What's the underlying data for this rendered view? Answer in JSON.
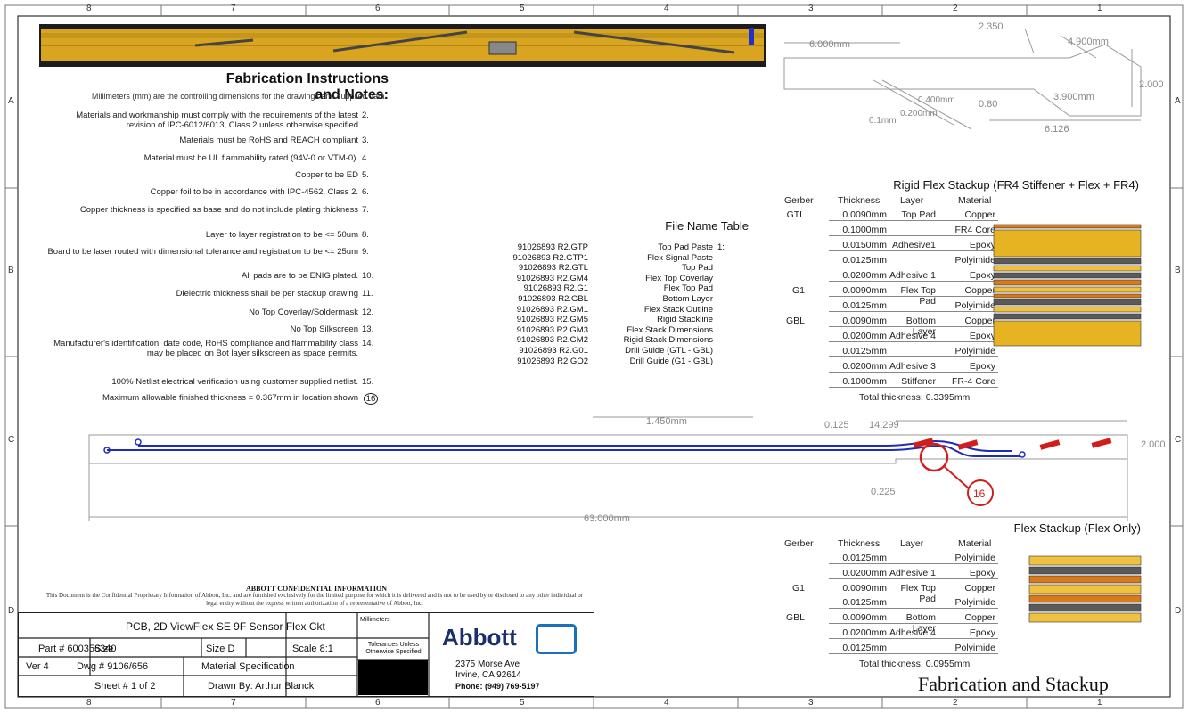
{
  "sheet": {
    "title": "Fabrication and Stackup",
    "zone_cols": [
      "8",
      "7",
      "6",
      "5",
      "4",
      "3",
      "2",
      "1"
    ],
    "zone_rows": [
      "A",
      "B",
      "C",
      "D"
    ]
  },
  "notes": {
    "heading": "Fabrication Instructions and Notes:",
    "subheading": "Millimeters (mm) are the controlling dimensions for the drawings and supplied data.",
    "items": [
      {
        "num": "2.",
        "text": "Materials and workmanship must comply with the requirements of the latest revision of IPC-6012/6013, Class 2 unless otherwise specified"
      },
      {
        "num": "3.",
        "text": "Materials must be RoHS and REACH compliant"
      },
      {
        "num": "4.",
        "text": "Material must be UL flammability rated (94V-0 or VTM-0)."
      },
      {
        "num": "5.",
        "text": "Copper to be ED"
      },
      {
        "num": "6.",
        "text": "Copper foil to be in accordance with IPC-4562, Class 2."
      },
      {
        "num": "7.",
        "text": "Copper thickness is specified as base and do not include plating thickness"
      },
      {
        "num": "8.",
        "text": "Layer to layer registration to be <= 50um"
      },
      {
        "num": "9.",
        "text": "Board to be laser routed with dimensional tolerance and registration to be <= 25um"
      },
      {
        "num": "10.",
        "text": "All pads are to be ENIG plated."
      },
      {
        "num": "11.",
        "text": "Dielectric thickness shall be per stackup drawing"
      },
      {
        "num": "12.",
        "text": "No Top Coverlay/Soldermask"
      },
      {
        "num": "13.",
        "text": "No Top Silkscreen"
      },
      {
        "num": "14.",
        "text": "Manufacturer's identification, date code, RoHS compliance and flammability class may be placed on Bot layer silkscreen as space permits."
      },
      {
        "num": "15.",
        "text": "100% Netlist electrical verification using customer supplied netlist."
      },
      {
        "num": "16",
        "text": "Maximum allowable finished thickness = 0.367mm in location shown"
      }
    ]
  },
  "file_table": {
    "heading": "File Name Table",
    "rows": [
      {
        "idx": "1:",
        "name": "Top Pad Paste",
        "file": "91026893 R2.GTP"
      },
      {
        "idx": "",
        "name": "Flex Signal Paste",
        "file": "91026893 R2.GTP1"
      },
      {
        "idx": "",
        "name": "Top Pad",
        "file": "91026893 R2.GTL"
      },
      {
        "idx": "",
        "name": "Flex Top Coverlay",
        "file": "91026893 R2.GM4"
      },
      {
        "idx": "",
        "name": "Flex Top Pad",
        "file": "91026893 R2.G1"
      },
      {
        "idx": "",
        "name": "Bottom Layer",
        "file": "91026893 R2.GBL"
      },
      {
        "idx": "",
        "name": "Flex Stack Outline",
        "file": "91026893 R2.GM1"
      },
      {
        "idx": "",
        "name": "Rigid Stackline",
        "file": "91026893 R2.GM5"
      },
      {
        "idx": "",
        "name": "Flex Stack Dimensions",
        "file": "91026893 R2.GM3"
      },
      {
        "idx": "",
        "name": "Rigid Stack Dimensions",
        "file": "91026893 R2.GM2"
      },
      {
        "idx": "",
        "name": "Drill Guide (GTL - GBL)",
        "file": "91026893 R2.G01"
      },
      {
        "idx": "",
        "name": "Drill Guide (G1 - GBL)",
        "file": "91026893 R2.GO2"
      }
    ]
  },
  "rigid_stack": {
    "heading": "Rigid Flex Stackup (FR4 Stiffener + Flex + FR4)",
    "cols": [
      "Material",
      "Layer",
      "Thickness",
      "Gerber"
    ],
    "rows": [
      {
        "material": "Copper",
        "layer": "Top Pad",
        "thickness": "0.0090mm",
        "gerber": "GTL"
      },
      {
        "material": "FR4 Core",
        "layer": "",
        "thickness": "0.1000mm",
        "gerber": ""
      },
      {
        "material": "Epoxy",
        "layer": "Adhesive1",
        "thickness": "0.0150mm",
        "gerber": ""
      },
      {
        "material": "Polyimide",
        "layer": "",
        "thickness": "0.0125mm",
        "gerber": ""
      },
      {
        "material": "Epoxy",
        "layer": "Adhesive 1",
        "thickness": "0.0200mm",
        "gerber": ""
      },
      {
        "material": "Copper",
        "layer": "Flex Top Pad",
        "thickness": "0.0090mm",
        "gerber": "G1"
      },
      {
        "material": "Polyimide",
        "layer": "",
        "thickness": "0.0125mm",
        "gerber": ""
      },
      {
        "material": "Copper",
        "layer": "Bottom Layer",
        "thickness": "0.0090mm",
        "gerber": "GBL"
      },
      {
        "material": "Epoxy",
        "layer": "Adhesive 4",
        "thickness": "0.0200mm",
        "gerber": ""
      },
      {
        "material": "Polyimide",
        "layer": "",
        "thickness": "0.0125mm",
        "gerber": ""
      },
      {
        "material": "Epoxy",
        "layer": "Adhesive 3",
        "thickness": "0.0200mm",
        "gerber": ""
      },
      {
        "material": "FR-4 Core",
        "layer": "Stiffener",
        "thickness": "0.1000mm",
        "gerber": ""
      }
    ],
    "total": "Total thickness: 0.3395mm"
  },
  "flex_stack": {
    "heading": "Flex Stackup (Flex Only)",
    "cols": [
      "Material",
      "Layer",
      "Thickness",
      "Gerber"
    ],
    "rows": [
      {
        "material": "Polyimide",
        "layer": "",
        "thickness": "0.0125mm",
        "gerber": ""
      },
      {
        "material": "Epoxy",
        "layer": "Adhesive 1",
        "thickness": "0.0200mm",
        "gerber": ""
      },
      {
        "material": "Copper",
        "layer": "Flex Top Pad",
        "thickness": "0.0090mm",
        "gerber": "G1"
      },
      {
        "material": "Polyimide",
        "layer": "",
        "thickness": "0.0125mm",
        "gerber": ""
      },
      {
        "material": "Copper",
        "layer": "Bottom Layer",
        "thickness": "0.0090mm",
        "gerber": "GBL"
      },
      {
        "material": "Epoxy",
        "layer": "Adhesive 4",
        "thickness": "0.0200mm",
        "gerber": ""
      },
      {
        "material": "Polyimide",
        "layer": "",
        "thickness": "0.0125mm",
        "gerber": ""
      }
    ],
    "total": "Total thickness: 0.0955mm"
  },
  "dims": {
    "top_right": [
      "6.000mm",
      "2.350",
      "4.900mm",
      "3.900mm",
      "2.000",
      "0.80",
      "6.126",
      "0.400mm",
      "0.200mm",
      "0.1mm"
    ],
    "board": [
      "14.299",
      "1.450mm",
      "0.125",
      "2.000",
      "0.225",
      "63.000mm"
    ],
    "callout": "16"
  },
  "confidential": {
    "heading": "ABBOTT CONFIDENTIAL INFORMATION",
    "text": "This Document is the Confidential Proprietary Information of Abbott, Inc. and are furnished exclusively for the limited purpose for which it is delivered and is not to be used by or disclosed to any other individual or legal entity without the express written authorization of a representative of Abbott, Inc."
  },
  "title_block": {
    "company": "Abbott",
    "address1": "2375 Morse Ave",
    "address2": "Irvine, CA 92614",
    "phone": "Phone: (949) 769-5197",
    "units": "Millimeters",
    "tolerance": "Tolerances Unless Otherwise Specified",
    "title": "PCB, 2D ViewFlex SE 9F Sensor Flex Ckt",
    "scale": "Scale 8:1",
    "size_label": "Size D",
    "size": "Size",
    "part": "Part # 600356340",
    "spec": "Material Specification",
    "dwg": "Dwg # 9106/656",
    "ver": "Ver 4",
    "drawn": "Drawn By: Arthur Blanck",
    "sheet": "Sheet # 1 of 2"
  },
  "colors": {
    "fr4": "#e6b422",
    "copper": "#d97a1a",
    "adhesive": "#5a5a5a",
    "trace": "#1e2cb8",
    "callout": "#d21d1d"
  }
}
